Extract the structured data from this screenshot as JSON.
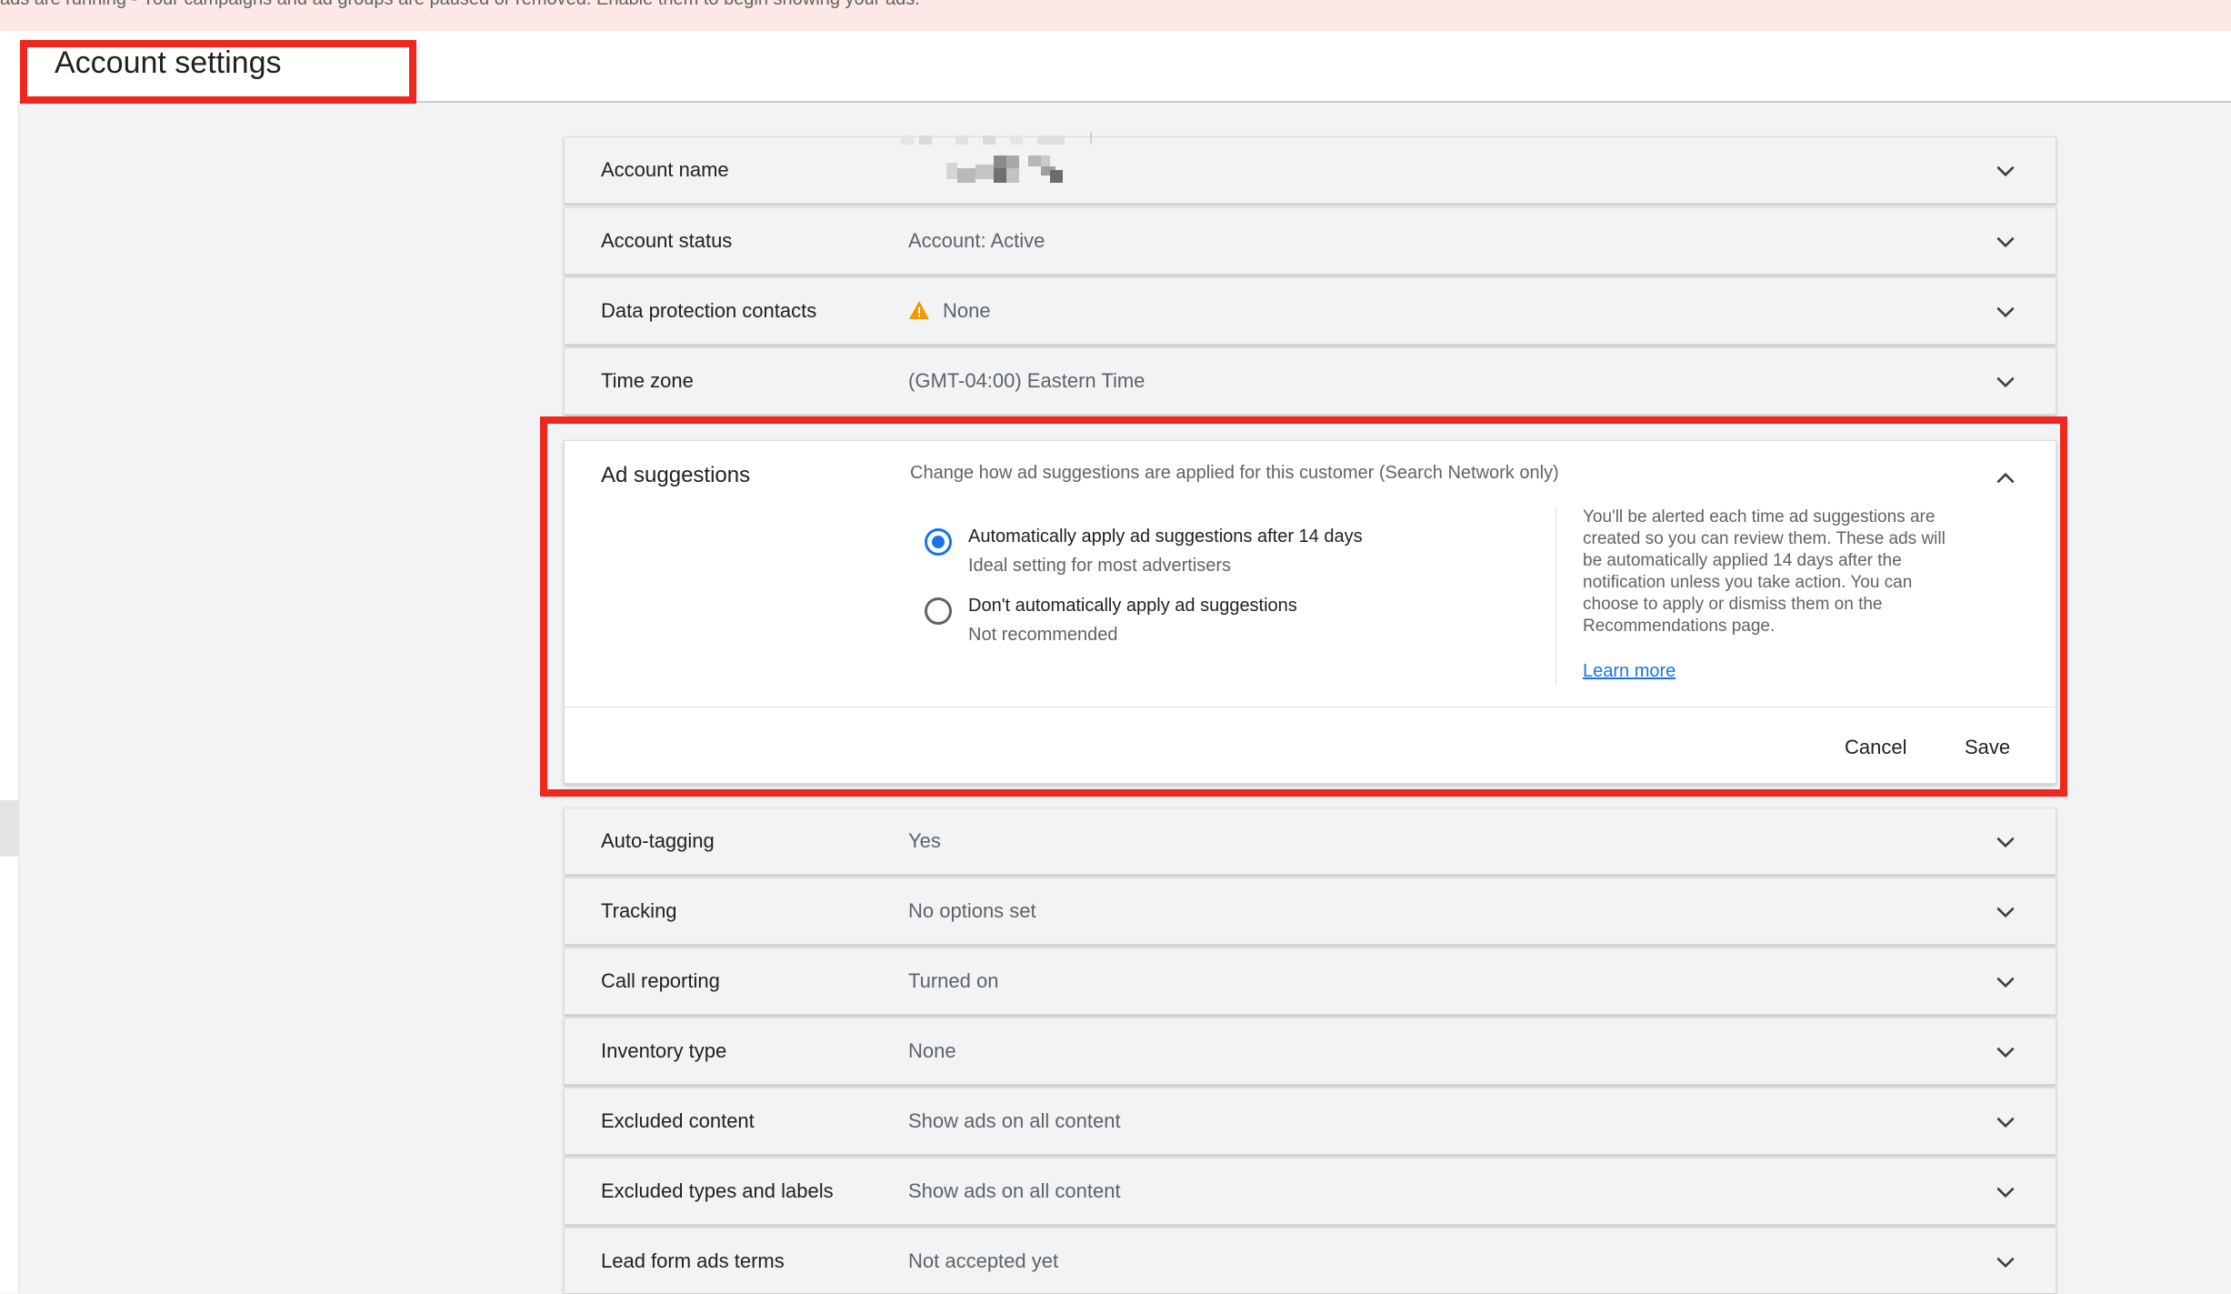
{
  "banner": {
    "text": "ads are running - Your campaigns and ad groups are paused or removed. Enable them to begin showing your ads."
  },
  "header": {
    "title": "Account settings"
  },
  "settings": [
    {
      "label": "Account name",
      "value": ""
    },
    {
      "label": "Account status",
      "value": "Account: Active"
    },
    {
      "label": "Data protection contacts",
      "value": "None"
    },
    {
      "label": "Time zone",
      "value": "(GMT-04:00) Eastern Time"
    }
  ],
  "ad_suggestions": {
    "label": "Ad suggestions",
    "description": "Change how ad suggestions are applied for this customer (Search Network only)",
    "options": [
      {
        "title": "Automatically apply ad suggestions after 14 days",
        "subtitle": "Ideal setting for most advertisers",
        "selected": true
      },
      {
        "title": "Don't automatically apply ad suggestions",
        "subtitle": "Not recommended",
        "selected": false
      }
    ],
    "help_text": "You'll be alerted each time ad suggestions are created so you can review them. These ads will be automatically applied 14 days after the notification unless you take action. You can choose to apply or dismiss them on the Recommendations page.",
    "learn_more": "Learn more",
    "cancel_label": "Cancel",
    "save_label": "Save"
  },
  "settings_below": [
    {
      "label": "Auto-tagging",
      "value": "Yes"
    },
    {
      "label": "Tracking",
      "value": "No options set"
    },
    {
      "label": "Call reporting",
      "value": "Turned on"
    },
    {
      "label": "Inventory type",
      "value": "None"
    },
    {
      "label": "Excluded content",
      "value": "Show ads on all content"
    },
    {
      "label": "Excluded types and labels",
      "value": "Show ads on all content"
    },
    {
      "label": "Lead form ads terms",
      "value": "Not accepted yet"
    }
  ],
  "colors": {
    "highlight": "#f0271c",
    "accent": "#1a73e8",
    "warning": "#f29900"
  }
}
